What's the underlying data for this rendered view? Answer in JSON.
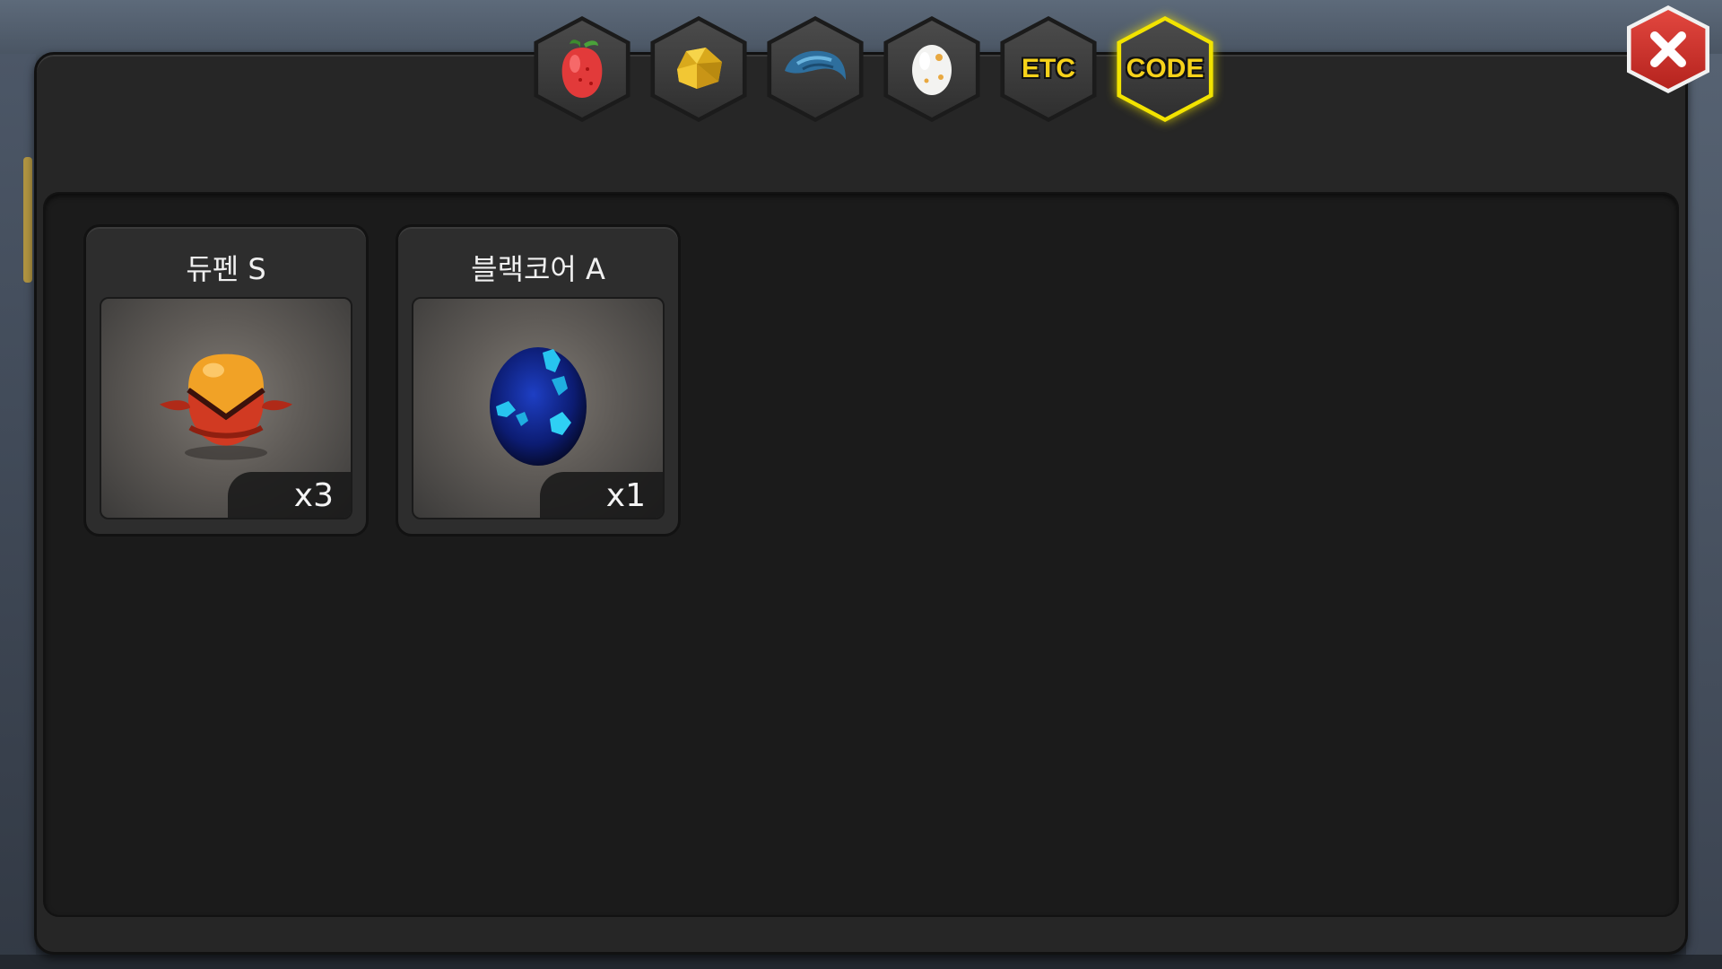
{
  "tabs": [
    {
      "type": "icon",
      "icon": "pepper-icon",
      "active": false
    },
    {
      "type": "icon",
      "icon": "gold-ore-icon",
      "active": false
    },
    {
      "type": "icon",
      "icon": "blue-scale-icon",
      "active": false
    },
    {
      "type": "icon",
      "icon": "egg-icon",
      "active": false
    },
    {
      "type": "text",
      "label": "ETC",
      "active": false
    },
    {
      "type": "text",
      "label": "CODE",
      "active": true
    }
  ],
  "close": {
    "icon": "close-icon"
  },
  "items": [
    {
      "name": "듀펜 S",
      "qty": "x3",
      "icon": "orange-red-egg-icon"
    },
    {
      "name": "블랙코어 A",
      "qty": "x1",
      "icon": "blue-black-egg-icon"
    }
  ],
  "colors": {
    "panel": "#262626",
    "inner": "#1b1b1b",
    "active_tab_border": "#f2e300",
    "tab_text": "#f6d21a",
    "close": "#d43a33"
  }
}
